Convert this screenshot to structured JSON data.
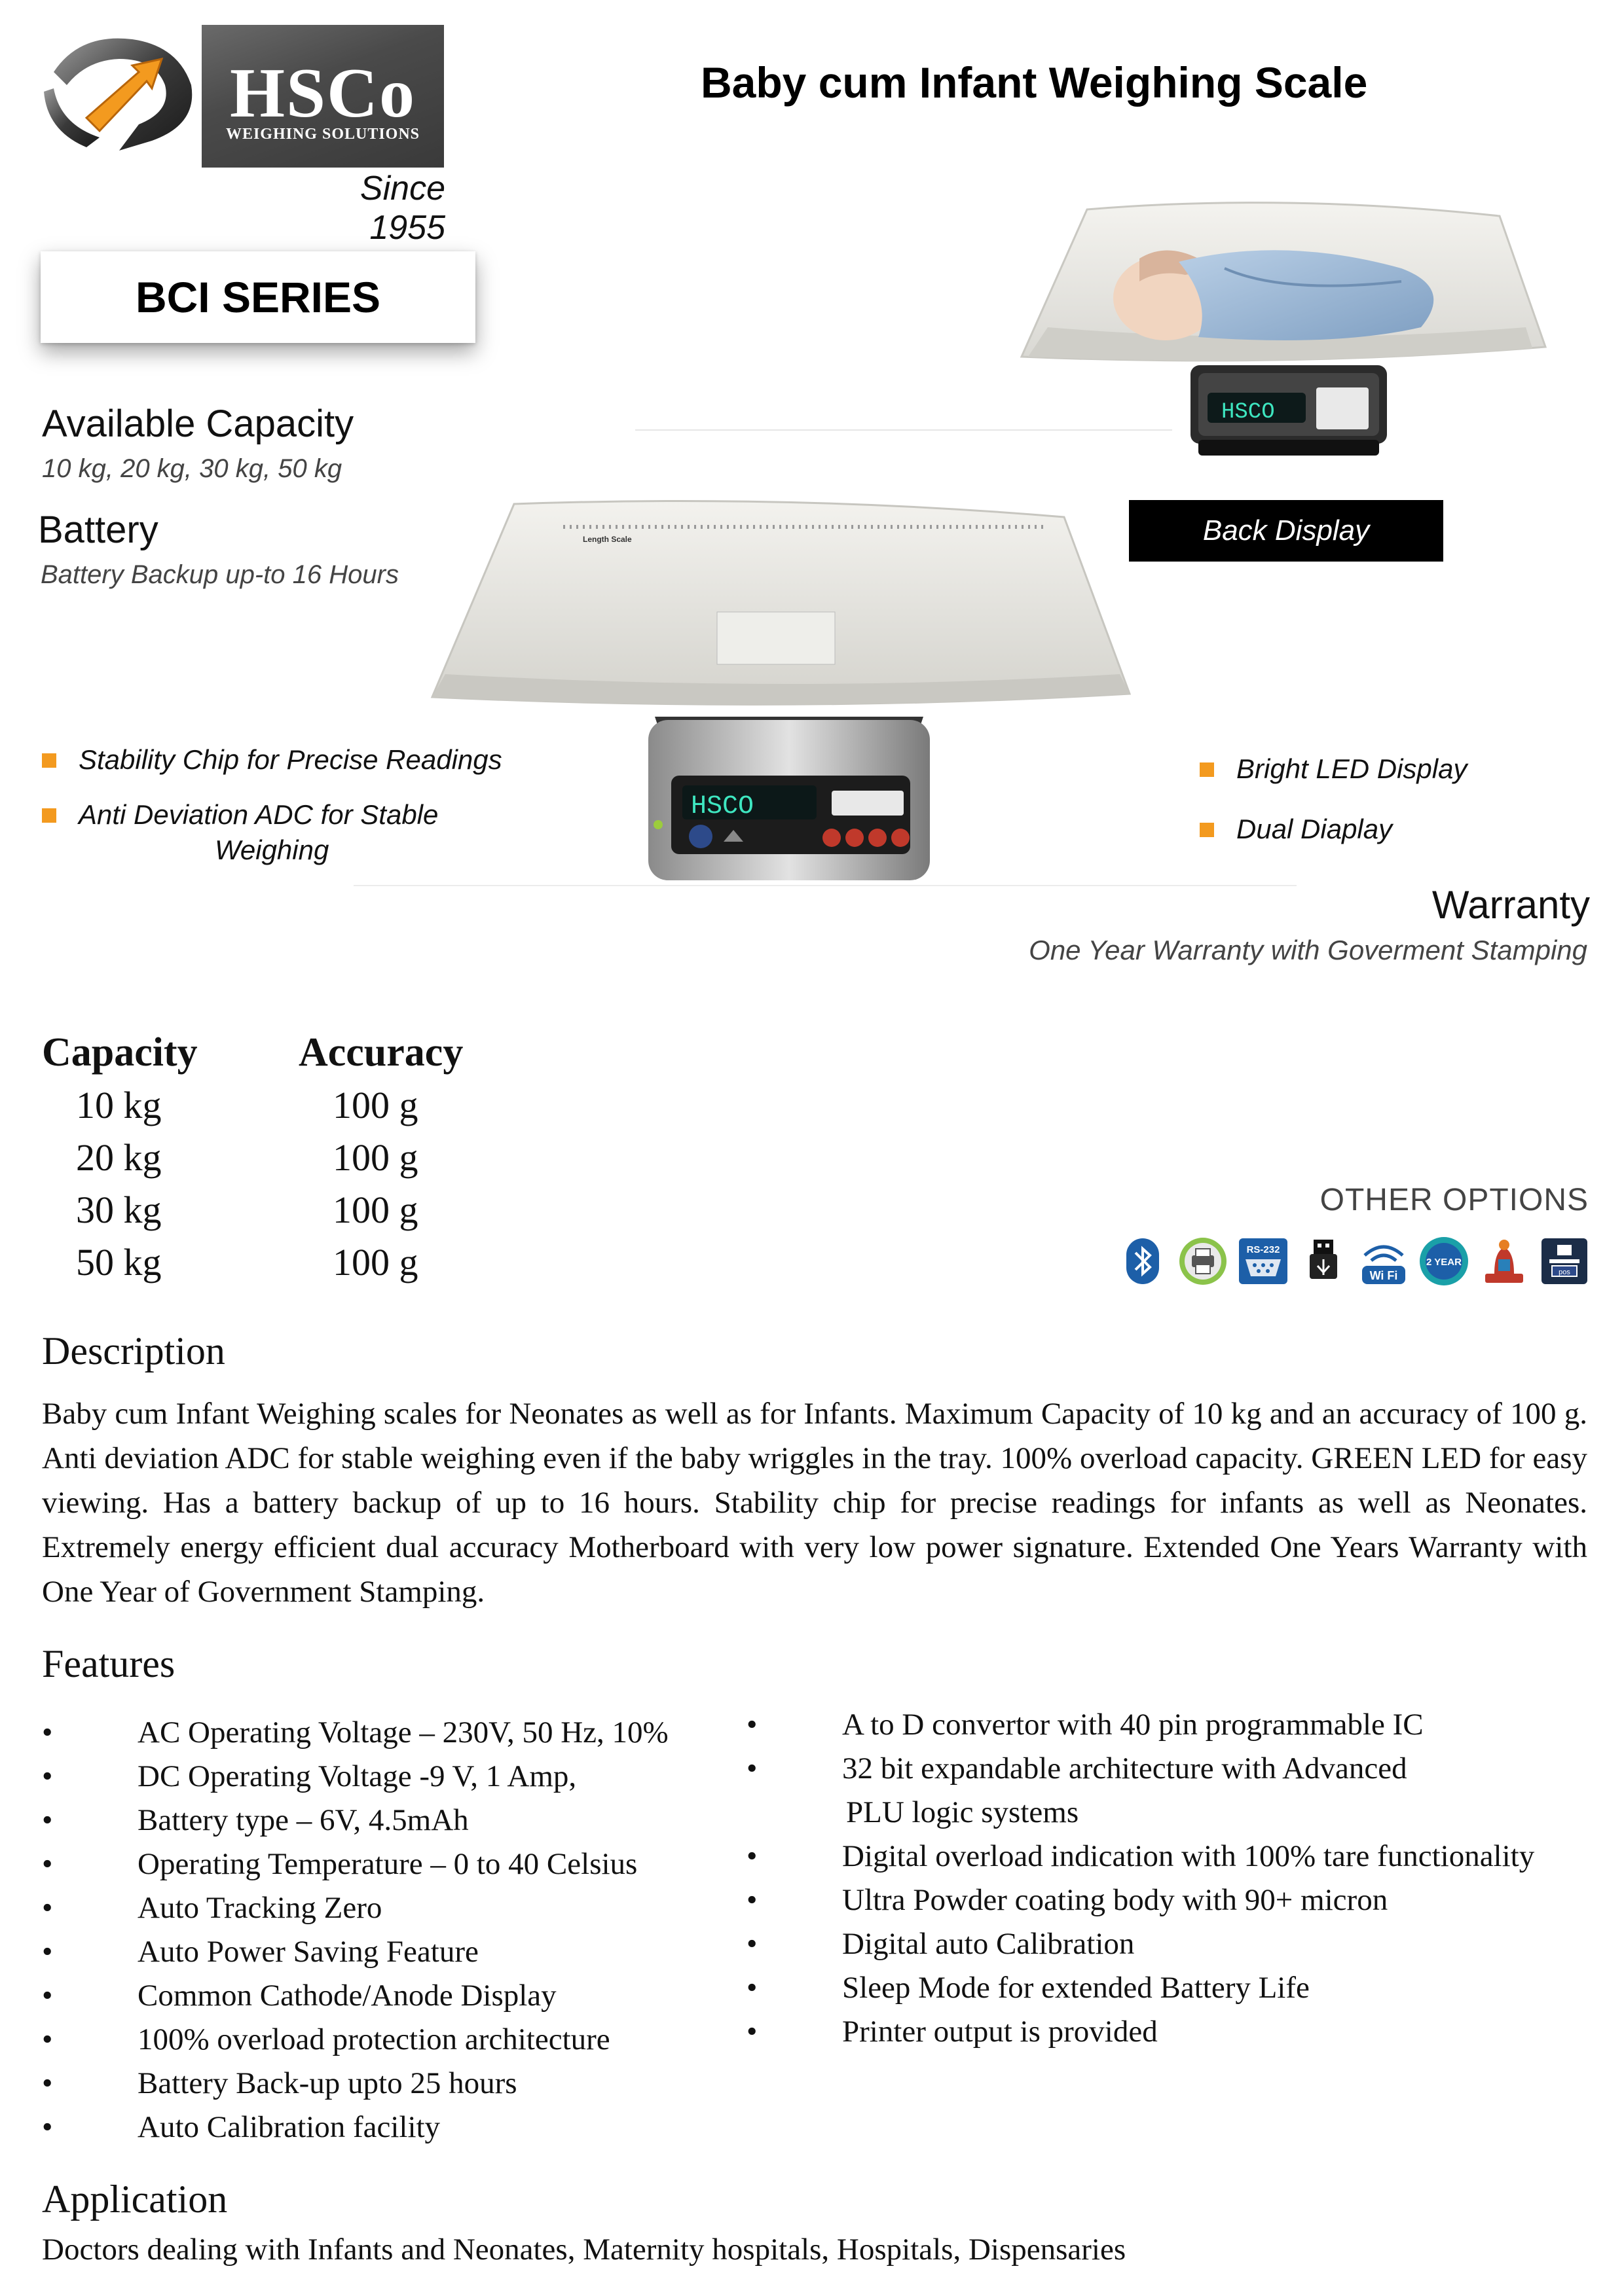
{
  "logo": {
    "brand": "HSCo",
    "tagline": "WEIGHING SOLUTIONS",
    "since": "Since 1955"
  },
  "title": "Baby cum Infant Weighing Scale",
  "series": "BCI SERIES",
  "specs": [
    {
      "heading": "Available Capacity",
      "detail": "10 kg, 20 kg, 30 kg, 50 kg"
    },
    {
      "heading": "Battery",
      "detail": "Battery Backup up-to 16 Hours"
    }
  ],
  "product_images": {
    "front_display_text": "HSCO",
    "back_display_text": "HSCO",
    "tray_label": "Length Scale"
  },
  "back_display_label": "Back Display",
  "left_bullets": [
    "Stability Chip for Precise Readings",
    "Anti Deviation ADC for Stable",
    "Weighing"
  ],
  "right_bullets": [
    "Bright LED Display",
    "Dual Diaplay"
  ],
  "warranty": {
    "heading": "Warranty",
    "detail": "One Year Warranty with Goverment Stamping"
  },
  "capacity_table": {
    "headers": [
      "Capacity",
      "Accuracy"
    ],
    "rows": [
      [
        "10 kg",
        "100 g"
      ],
      [
        "20 kg",
        "100 g"
      ],
      [
        "30 kg",
        "100 g"
      ],
      [
        "50 kg",
        "100 g"
      ]
    ]
  },
  "other_options": {
    "label": "OTHER OPTIONS",
    "icons": [
      "bluetooth-icon",
      "printer-icon",
      "rs232-icon",
      "usb-icon",
      "wifi-icon",
      "two-year-warranty-icon",
      "stamp-icon",
      "pos-icon"
    ],
    "icon_texts": {
      "rs232": "RS-232",
      "wifi": "Wi Fi",
      "warranty": "2 YEAR",
      "pos": "pos"
    }
  },
  "description": {
    "heading": "Description",
    "text": "Baby cum Infant Weighing scales for Neonates as well as for Infants. Maximum Capacity of 10 kg and an accuracy of 100 g. Anti deviation ADC for stable weighing even if the baby wriggles in the tray. 100% overload capacity. GREEN LED for easy viewing. Has a battery backup of up to 16 hours. Stability chip for precise readings for infants as well as Neonates. Extremely energy efficient dual accuracy Motherboard with very low power signature. Extended One Years Warranty with One Year of Government Stamping."
  },
  "features": {
    "heading": "Features",
    "bullet": "•",
    "left": [
      "AC Operating Voltage – 230V, 50 Hz, 10%",
      "DC Operating Voltage -9 V, 1 Amp,",
      "Battery type – 6V, 4.5mAh",
      "Operating Temperature – 0 to 40 Celsius",
      "Auto Tracking Zero",
      "Auto Power Saving Feature",
      "Common Cathode/Anode Display",
      "100% overload protection architecture",
      "Battery Back-up upto 25 hours",
      "Auto Calibration facility"
    ],
    "right": [
      "A to D convertor with 40 pin programmable IC",
      "32 bit expandable architecture with Advanced",
      "PLU logic systems",
      "Digital overload indication with 100% tare functionality",
      "Ultra Powder coating body with 90+ micron",
      "Digital auto Calibration",
      "Sleep Mode for extended Battery Life",
      "Printer output is provided"
    ]
  },
  "application": {
    "heading": "Application",
    "text": "Doctors dealing with Infants and Neonates, Maternity hospitals, Hospitals, Dispensaries"
  },
  "colors": {
    "bullet_square": "#f39a1f",
    "logo_box": "#4a4a4a",
    "led_green": "#3ee6c0",
    "label_bg": "#000000"
  }
}
